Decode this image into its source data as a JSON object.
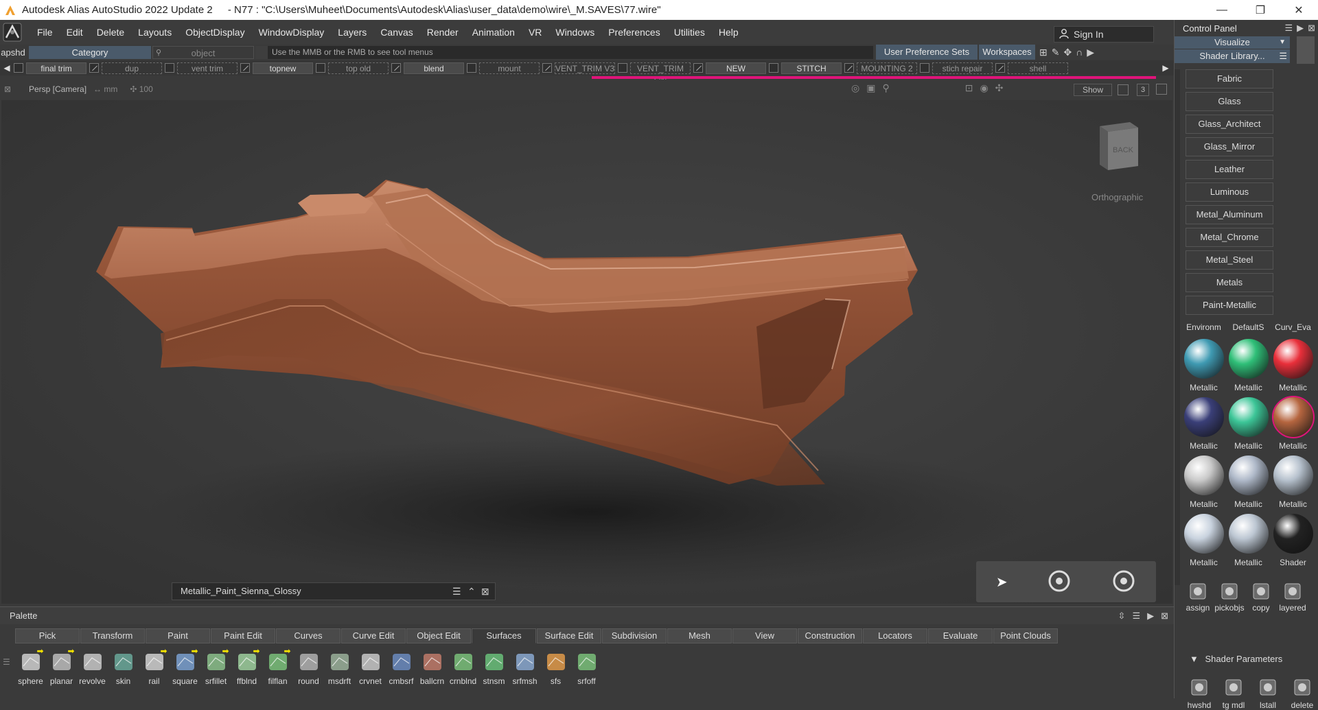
{
  "window": {
    "app_title": "Autodesk Alias AutoStudio 2022 Update 2",
    "file_path": "- N77 : \"C:\\Users\\Muheet\\Documents\\Autodesk\\Alias\\user_data\\demo\\wire\\_M.SAVES\\77.wire\"",
    "controls": [
      "—",
      "❐",
      "✕"
    ]
  },
  "menubar": {
    "items": [
      "File",
      "Edit",
      "Delete",
      "Layouts",
      "ObjectDisplay",
      "WindowDisplay",
      "Layers",
      "Canvas",
      "Render",
      "Animation",
      "VR",
      "Windows",
      "Preferences",
      "Utilities",
      "Help"
    ],
    "sign_in": "Sign In"
  },
  "toolbar": {
    "apshd": "apshd",
    "category": "Category",
    "object_placeholder": "object",
    "hint": "Use the MMB or the RMB to see tool menus",
    "user_pref_sets": "User Preference Sets",
    "workspaces": "Workspaces"
  },
  "shelf": {
    "items": [
      {
        "label": "final trim",
        "style": "btn",
        "w": 88
      },
      {
        "label": "dup",
        "style": "dash",
        "w": 88
      },
      {
        "label": "vent trim",
        "style": "dash",
        "w": 88
      },
      {
        "label": "topnew",
        "style": "btn",
        "w": 88
      },
      {
        "label": "top old",
        "style": "dash",
        "w": 88
      },
      {
        "label": "blend",
        "style": "btn",
        "w": 88
      },
      {
        "label": "mount",
        "style": "dash",
        "w": 88
      },
      {
        "label": "VENT_TRIM V3",
        "style": "dash",
        "w": 88
      },
      {
        "label": "VENT_TRIM LIN",
        "style": "dash",
        "w": 88
      },
      {
        "label": "NEW",
        "style": "btn",
        "w": 88
      },
      {
        "label": "STITCH",
        "style": "btn",
        "w": 88
      },
      {
        "label": "MOUNTING 2",
        "style": "dash",
        "w": 88
      },
      {
        "label": "stich repair",
        "style": "dash",
        "w": 88
      },
      {
        "label": "shell",
        "style": "dash",
        "w": 88
      }
    ]
  },
  "viewport": {
    "camera_label": "Persp [Camera]",
    "units": "↔ mm",
    "zoom": "✣ 100",
    "show_button": "Show",
    "layer_num": "3",
    "ortho_label": "Orthographic",
    "viewcube_face": "BACK",
    "shader_name": "Metallic_Paint_Sienna_Glossy"
  },
  "palette": {
    "title": "Palette",
    "tabs": [
      "Pick",
      "Transform",
      "Paint",
      "Paint Edit",
      "Curves",
      "Curve Edit",
      "Object Edit",
      "Surfaces",
      "Surface Edit",
      "Subdivision",
      "Mesh",
      "View",
      "Construction",
      "Locators",
      "Evaluate",
      "Point Clouds"
    ],
    "active_tab": "Surfaces",
    "tools": [
      {
        "label": "sphere",
        "icon": "sphere-icon",
        "arrow": true
      },
      {
        "label": "planar",
        "icon": "planar-icon",
        "arrow": true
      },
      {
        "label": "revolve",
        "icon": "revolve-icon",
        "arrow": false
      },
      {
        "label": "skin",
        "icon": "skin-icon",
        "arrow": false
      },
      {
        "label": "rail",
        "icon": "rail-icon",
        "arrow": true
      },
      {
        "label": "square",
        "icon": "square-icon",
        "arrow": true
      },
      {
        "label": "srfillet",
        "icon": "srfillet-icon",
        "arrow": true
      },
      {
        "label": "ffblnd",
        "icon": "ffblnd-icon",
        "arrow": true
      },
      {
        "label": "filflan",
        "icon": "filflan-icon",
        "arrow": true
      },
      {
        "label": "round",
        "icon": "round-icon",
        "arrow": false
      },
      {
        "label": "msdrft",
        "icon": "msdrft-icon",
        "arrow": false
      },
      {
        "label": "crvnet",
        "icon": "crvnet-icon",
        "arrow": false
      },
      {
        "label": "cmbsrf",
        "icon": "cmbsrf-icon",
        "arrow": false
      },
      {
        "label": "ballcrn",
        "icon": "ballcrn-icon",
        "arrow": false
      },
      {
        "label": "crnblnd",
        "icon": "crnblnd-icon",
        "arrow": false
      },
      {
        "label": "stnsm",
        "icon": "stnsm-icon",
        "arrow": false
      },
      {
        "label": "srfmsh",
        "icon": "srfmsh-icon",
        "arrow": false
      },
      {
        "label": "sfs",
        "icon": "sfs-icon",
        "arrow": false
      },
      {
        "label": "srfoff",
        "icon": "srfoff-icon",
        "arrow": false
      }
    ]
  },
  "control_panel": {
    "title": "Control Panel",
    "visualize": "Visualize",
    "shader_library": "Shader Library...",
    "categories": [
      "Fabric",
      "Glass",
      "Glass_Architect",
      "Glass_Mirror",
      "Leather",
      "Luminous",
      "Metal_Aluminum",
      "Metal_Chrome",
      "Metal_Steel",
      "Metals",
      "Paint-Metallic"
    ],
    "swatch_headers": [
      "Environm",
      "DefaultS",
      "Curv_Eva"
    ],
    "swatches": [
      {
        "label": "Metallic",
        "color": "#3f9ab2"
      },
      {
        "label": "Metallic",
        "color": "#2fbf78"
      },
      {
        "label": "Metallic",
        "color": "#e82f3a"
      },
      {
        "label": "Metallic",
        "color": "#3a3f78"
      },
      {
        "label": "Metallic",
        "color": "#3cc597"
      },
      {
        "label": "Metallic",
        "color": "#b5653f",
        "selected": true
      },
      {
        "label": "Metallic",
        "color": "#c9c9c9"
      },
      {
        "label": "Metallic",
        "color": "#aeb8c8"
      },
      {
        "label": "Metallic",
        "color": "#b5c0cc"
      },
      {
        "label": "Metallic",
        "color": "#c8d2de"
      },
      {
        "label": "Metallic",
        "color": "#bcc6d2"
      },
      {
        "label": "Shader",
        "color": "#222222"
      }
    ],
    "tools": [
      {
        "label": "assign",
        "icon": "assign-icon"
      },
      {
        "label": "pickobjs",
        "icon": "pickobjs-icon"
      },
      {
        "label": "copy",
        "icon": "copy-icon"
      },
      {
        "label": "layered",
        "icon": "layered-icon"
      }
    ],
    "shader_parameters": "Shader Parameters",
    "tools2": [
      {
        "label": "hwshd",
        "icon": "hwshd-icon"
      },
      {
        "label": "tg mdl",
        "icon": "tgmdl-icon"
      },
      {
        "label": "lstall",
        "icon": "lstall-icon"
      },
      {
        "label": "delete",
        "icon": "delete-icon"
      }
    ]
  },
  "colors": {
    "accent_magenta": "#e0147a",
    "model_copper": "#b06a4a"
  }
}
